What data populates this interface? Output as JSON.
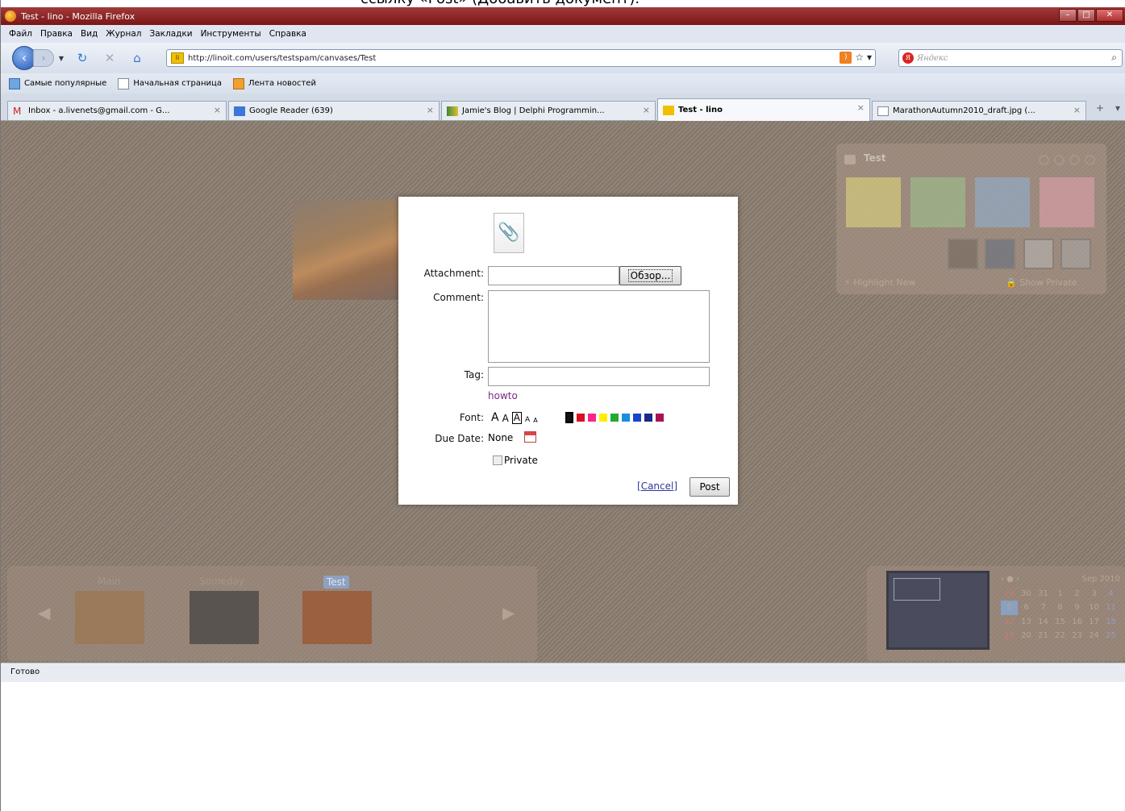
{
  "caption": "ссылку «Post» (Добавить документ).",
  "window": {
    "title": "Test - lino - Mozilla Firefox"
  },
  "menu": [
    "Файл",
    "Правка",
    "Вид",
    "Журнал",
    "Закладки",
    "Инструменты",
    "Справка"
  ],
  "nav": {
    "url": "http://linoit.com/users/testspam/canvases/Test",
    "search_placeholder": "Яндекс"
  },
  "bookmarks": [
    "Самые популярные",
    "Начальная страница",
    "Лента новостей"
  ],
  "tabs": [
    {
      "label": "Inbox - a.livenets@gmail.com - G..."
    },
    {
      "label": "Google Reader (639)"
    },
    {
      "label": "Jamie's Blog | Delphi Programmin..."
    },
    {
      "label": "Test - lino"
    },
    {
      "label": "MarathonAutumn2010_draft.jpg (..."
    }
  ],
  "board": {
    "title": "Test",
    "highlight": "Highlight New",
    "show_private": "Show Private"
  },
  "dock": {
    "canvases": [
      "Main",
      "Someday",
      "Test"
    ]
  },
  "calendar": {
    "month": "Sep 2010",
    "rows": [
      [
        "29",
        "30",
        "31",
        "1",
        "2",
        "3",
        "4"
      ],
      [
        "5",
        "6",
        "7",
        "8",
        "9",
        "10",
        "11"
      ],
      [
        "12",
        "13",
        "14",
        "15",
        "16",
        "17",
        "18"
      ],
      [
        "19",
        "20",
        "21",
        "22",
        "23",
        "24",
        "25"
      ]
    ]
  },
  "status": "Готово",
  "dialog": {
    "attachment_label": "Attachment:",
    "browse_label": "Обзор...",
    "comment_label": "Comment:",
    "tag_label": "Tag:",
    "howto": "howto",
    "font_label": "Font:",
    "font_sizes": [
      "A",
      "A",
      "A",
      "A",
      "A"
    ],
    "due_label": "Due Date:",
    "due_value": "None",
    "private_label": "Private",
    "cancel_label": "Cancel",
    "post_label": "Post",
    "colors": [
      "#111111",
      "#d81020",
      "#ff2288",
      "#ffee00",
      "#22aa33",
      "#1a8ee0",
      "#1a44cc",
      "#1a2a88",
      "#aa1155"
    ]
  }
}
